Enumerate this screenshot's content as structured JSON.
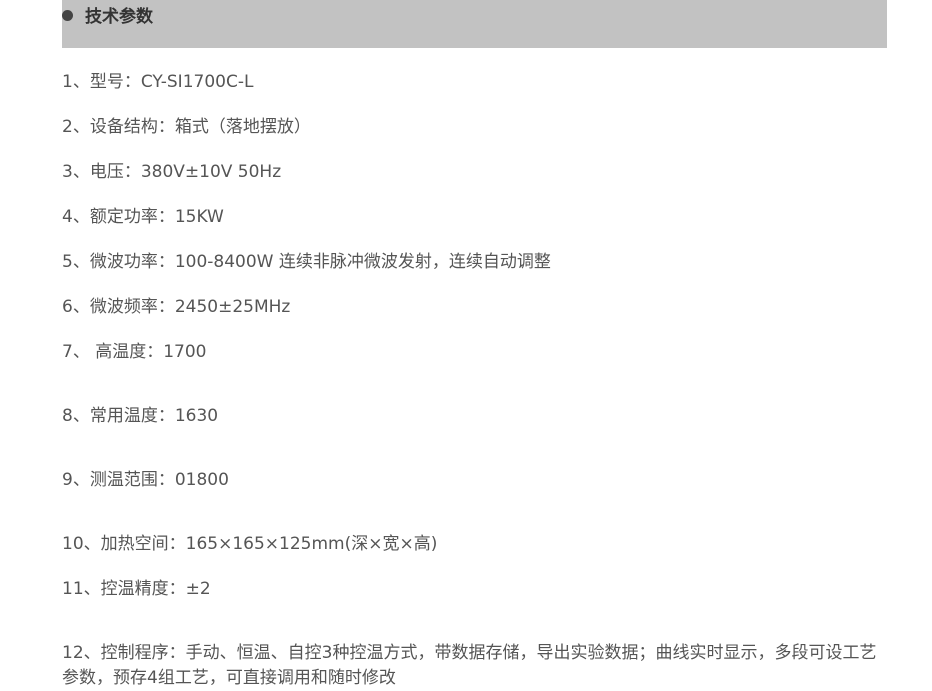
{
  "section": {
    "title": "技术参数"
  },
  "specs": [
    "1、型号：CY-SI1700C-L",
    "2、设备结构：箱式（落地摆放）",
    "3、电压：380V±10V  50Hz",
    "4、额定功率：15KW",
    "5、微波功率：100-8400W  连续非脉冲微波发射，连续自动调整",
    "6、微波频率：2450±25MHz",
    "7、 高温度：1700",
    "8、常用温度：1630",
    "9、测温范围：01800",
    "10、加热空间：165×165×125mm(深×宽×高)",
    "11、控温精度：±2",
    "12、控制程序：手动、恒温、自控3种控温方式，带数据存储，导出实验数据；曲线实时显示，多段可设工艺参数，预存4组工艺，可直接调用和随时修改"
  ]
}
